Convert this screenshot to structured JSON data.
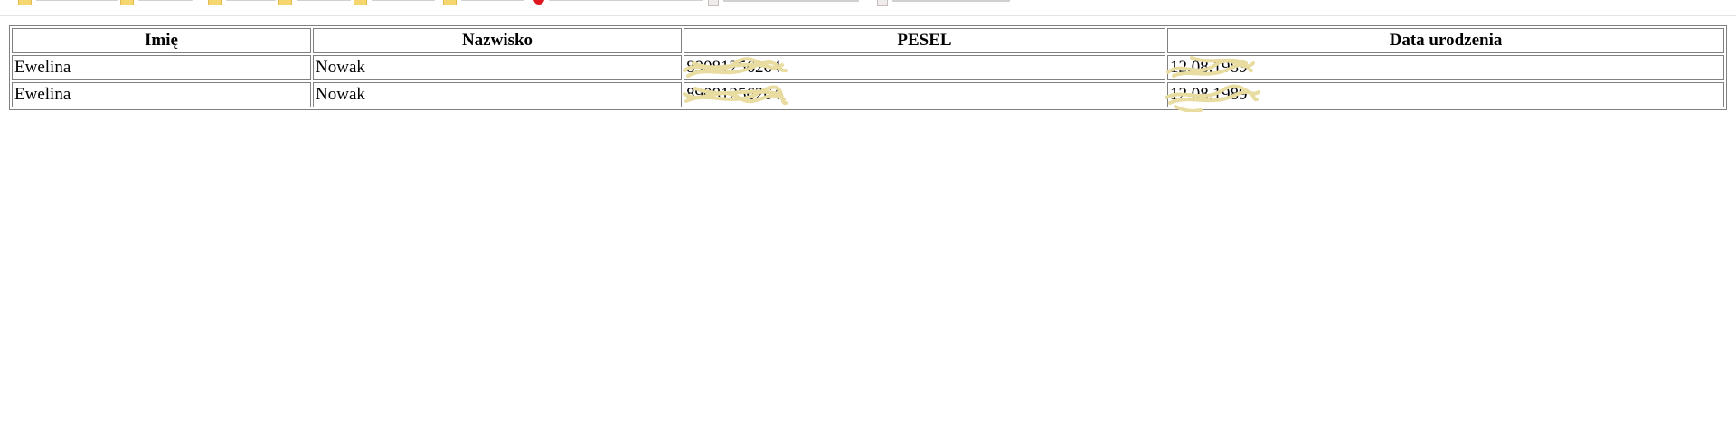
{
  "bookmarks_bar": {
    "items": [
      {
        "icon": "folder-icon"
      },
      {
        "icon": "folder-icon"
      },
      {
        "icon": "folder-icon"
      },
      {
        "icon": "folder-icon"
      },
      {
        "icon": "folder-icon"
      },
      {
        "icon": "folder-icon"
      },
      {
        "icon": "red-circle-icon"
      },
      {
        "icon": "page-icon"
      },
      {
        "icon": "page-icon"
      }
    ]
  },
  "table": {
    "headers": [
      "Imię",
      "Nazwisko",
      "PESEL",
      "Data urodzenia"
    ],
    "rows": [
      {
        "imie": "Ewelina",
        "nazwisko": "Nowak",
        "pesel": "89081256264",
        "data_urodzenia": "12.08.1989"
      },
      {
        "imie": "Ewelina",
        "nazwisko": "Nowak",
        "pesel": "89081256264",
        "data_urodzenia": "12.08.1989"
      }
    ]
  },
  "colors": {
    "redaction_scribble": "#e8dca0",
    "table_border": "#808080"
  }
}
